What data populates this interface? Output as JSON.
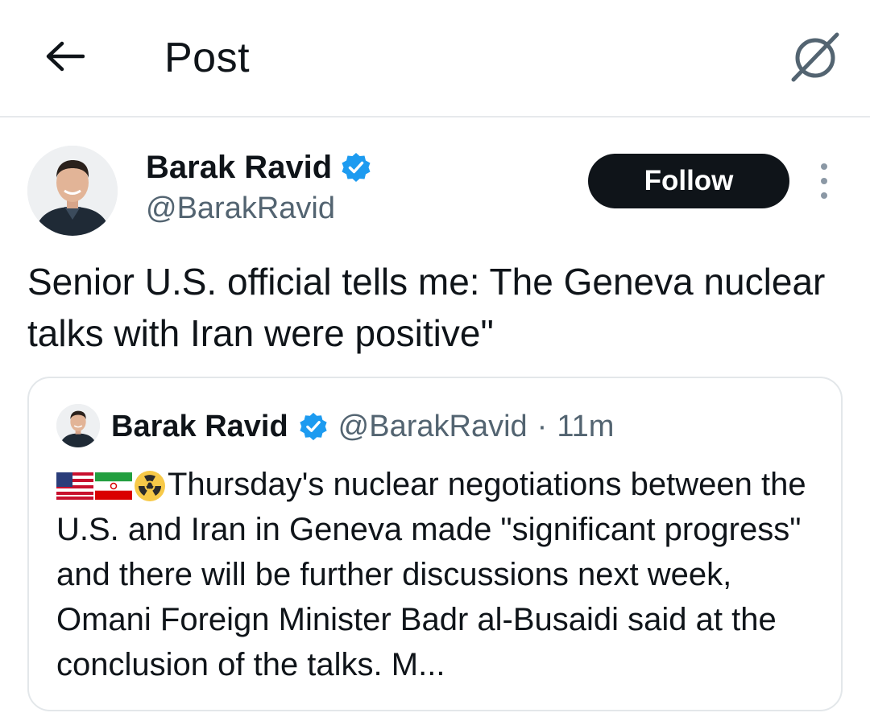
{
  "header": {
    "title": "Post",
    "back_icon": "arrow-left-icon",
    "grok_icon": "grok-icon"
  },
  "post": {
    "author_name": "Barak Ravid",
    "author_handle": "@BarakRavid",
    "verified": true,
    "follow_label": "Follow",
    "text": "Senior U.S. official tells me: The Geneva nuclear talks with Iran were positive\""
  },
  "quote": {
    "author_name": "Barak Ravid",
    "author_handle": "@BarakRavid",
    "separator": "·",
    "time": "11m",
    "emojis": [
      "us-flag-icon",
      "iran-flag-icon",
      "radioactive-icon"
    ],
    "text": "Thursday's nuclear negotiations between the U.S. and Iran in Geneva made \"significant progress\" and there will be further discussions next week, Omani Foreign Minister Badr al-Busaidi said at the conclusion of the talks. M..."
  },
  "colors": {
    "text_primary": "#0f1419",
    "text_secondary": "#536471",
    "verified_blue": "#1d9bf0",
    "follow_bg": "#0f1419",
    "border": "#e3e7ea"
  }
}
